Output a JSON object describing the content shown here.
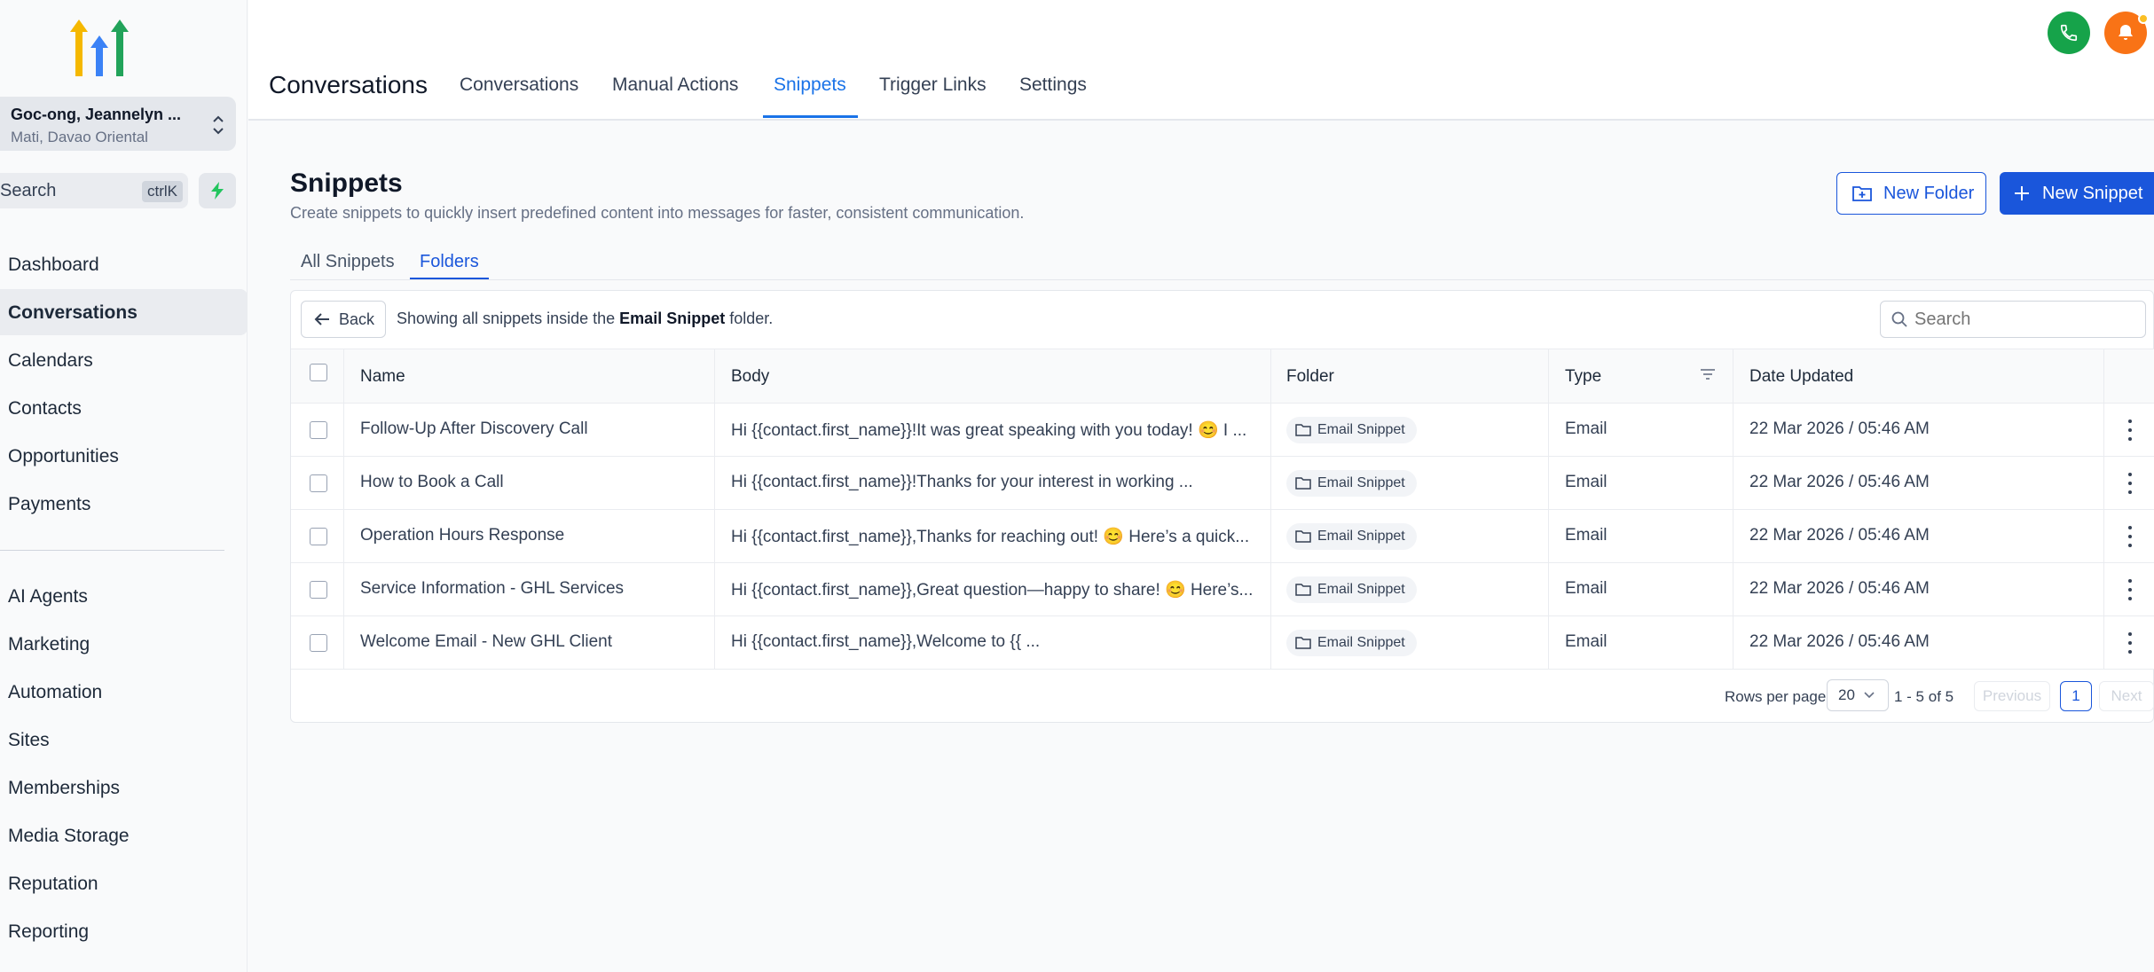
{
  "location": {
    "name": "Goc-ong, Jeannelyn ...",
    "sub": "Mati, Davao Oriental"
  },
  "sidebar": {
    "search_label": "Search",
    "shortcut": "ctrlK",
    "items": [
      {
        "label": "Dashboard"
      },
      {
        "label": "Conversations"
      },
      {
        "label": "Calendars"
      },
      {
        "label": "Contacts"
      },
      {
        "label": "Opportunities"
      },
      {
        "label": "Payments"
      },
      {
        "label": "AI Agents"
      },
      {
        "label": "Marketing"
      },
      {
        "label": "Automation"
      },
      {
        "label": "Sites"
      },
      {
        "label": "Memberships"
      },
      {
        "label": "Media Storage"
      },
      {
        "label": "Reputation"
      },
      {
        "label": "Reporting"
      }
    ]
  },
  "header": {
    "title": "Conversations",
    "tabs": [
      {
        "label": "Conversations"
      },
      {
        "label": "Manual Actions"
      },
      {
        "label": "Snippets"
      },
      {
        "label": "Trigger Links"
      },
      {
        "label": "Settings"
      }
    ],
    "active_tab": "Snippets"
  },
  "page": {
    "title": "Snippets",
    "description": "Create snippets to quickly insert predefined content into messages for faster, consistent communication.",
    "new_folder_label": "New Folder",
    "new_snippet_label": "New Snippet",
    "subtabs": [
      {
        "label": "All Snippets"
      },
      {
        "label": "Folders"
      }
    ],
    "active_subtab": "Folders"
  },
  "folder_view": {
    "back_label": "Back",
    "showing_prefix": "Showing all snippets inside the",
    "folder_name": "Email Snippet",
    "showing_suffix": "folder.",
    "search_placeholder": "Search"
  },
  "table": {
    "columns": [
      "Name",
      "Body",
      "Folder",
      "Type",
      "Date Updated"
    ],
    "rows": [
      {
        "name": "Follow-Up After Discovery Call",
        "body": "Hi {{contact.first_name}}!It was great speaking with you today! 😊 I ...",
        "folder": "Email Snippet",
        "type": "Email",
        "date": "22 Mar 2026 / 05:46 AM"
      },
      {
        "name": "How to Book a Call",
        "body": "Hi {{contact.first_name}}!Thanks for your interest in working ...",
        "folder": "Email Snippet",
        "type": "Email",
        "date": "22 Mar 2026 / 05:46 AM"
      },
      {
        "name": "Operation Hours Response",
        "body": "Hi {{contact.first_name}},Thanks for reaching out! 😊 Here’s a quick...",
        "folder": "Email Snippet",
        "type": "Email",
        "date": "22 Mar 2026 / 05:46 AM"
      },
      {
        "name": "Service Information - GHL Services",
        "body": "Hi {{contact.first_name}},Great question—happy to share! 😊 Here’s...",
        "folder": "Email Snippet",
        "type": "Email",
        "date": "22 Mar 2026 / 05:46 AM"
      },
      {
        "name": "Welcome Email - New GHL Client",
        "body": "Hi {{contact.first_name}},Welcome to {{ ...",
        "folder": "Email Snippet",
        "type": "Email",
        "date": "22 Mar 2026 / 05:46 AM"
      }
    ]
  },
  "pagination": {
    "rows_per_page_label": "Rows per page",
    "rows_per_page": "20",
    "range": "1 - 5 of 5",
    "previous": "Previous",
    "page": "1",
    "next": "Next"
  },
  "colors": {
    "accent": "#1a56db",
    "phone": "#16a34a",
    "bell": "#f97316"
  }
}
